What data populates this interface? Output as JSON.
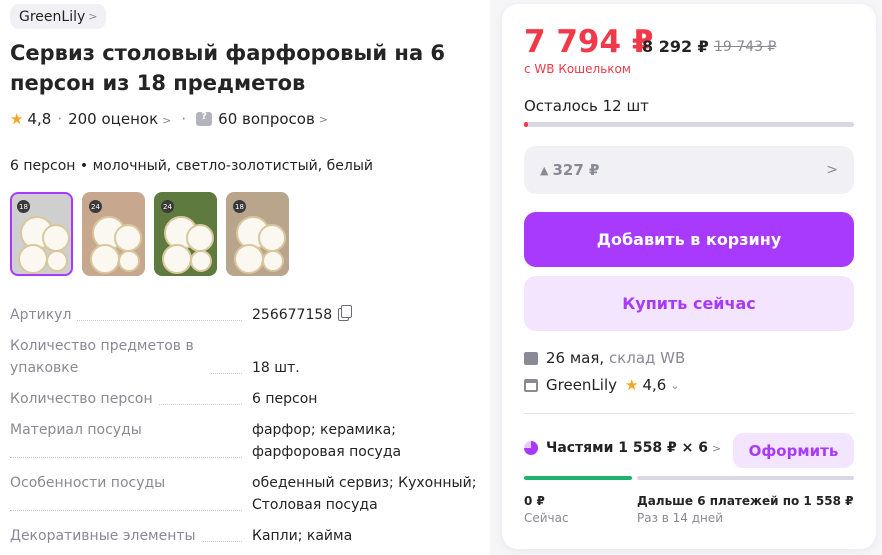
{
  "brand": {
    "name": "GreenLily"
  },
  "product": {
    "title": "Сервиз столовый фарфоровый на 6 персон из 18 предметов",
    "rating": "4,8",
    "reviews": "200 оценок",
    "questions": "60 вопросов",
    "variant": "6 персон • молочный, светло-золотистый, белый"
  },
  "thumbnails": [
    {
      "badge": "18",
      "bg": "#cfcfcf",
      "active": true
    },
    {
      "badge": "24",
      "bg": "#c7a88f",
      "active": false
    },
    {
      "badge": "24",
      "bg": "#5e7a3e",
      "active": false
    },
    {
      "badge": "18",
      "bg": "#b9a48c",
      "active": false
    }
  ],
  "specs": [
    {
      "key": "Артикул",
      "value": "256677158"
    },
    {
      "key": "Количество предметов в упаковке",
      "value": "18 шт."
    },
    {
      "key": "Количество персон",
      "value": "6 персон"
    },
    {
      "key": "Материал посуды",
      "value": "фарфор; керамика; фарфоровая посуда"
    },
    {
      "key": "Особенности посуды",
      "value": "обеденный сервиз; Кухонный; Столовая посуда"
    },
    {
      "key": "Декоративные элементы",
      "value": "Капли; кайма"
    }
  ],
  "buy_card": {
    "price": "7 794 ₽",
    "price_secondary": "8 292 ₽",
    "price_old": "19 743 ₽",
    "wallet_note": "с WB Кошельком",
    "stock_text": "Осталось 12 шт",
    "stock_fraction": 0.012,
    "points_text": "327 ₽",
    "add_to_cart": "Добавить в корзину",
    "buy_now": "Купить сейчас",
    "delivery_date": "26 мая,",
    "delivery_source": "склад WB",
    "seller_name": "GreenLily",
    "seller_rating": "4,6",
    "split_text": "Частями 1 558 ₽ × 6",
    "split_button": "Оформить",
    "pay_now_value": "0 ₽",
    "pay_now_label": "Сейчас",
    "pay_later_value": "Дальше 6 платежей по 1 558 ₽",
    "pay_later_label": "Раз в 14 дней"
  },
  "colors": {
    "accent": "#a73afd",
    "price": "#f2394a",
    "green": "#1fb370"
  }
}
